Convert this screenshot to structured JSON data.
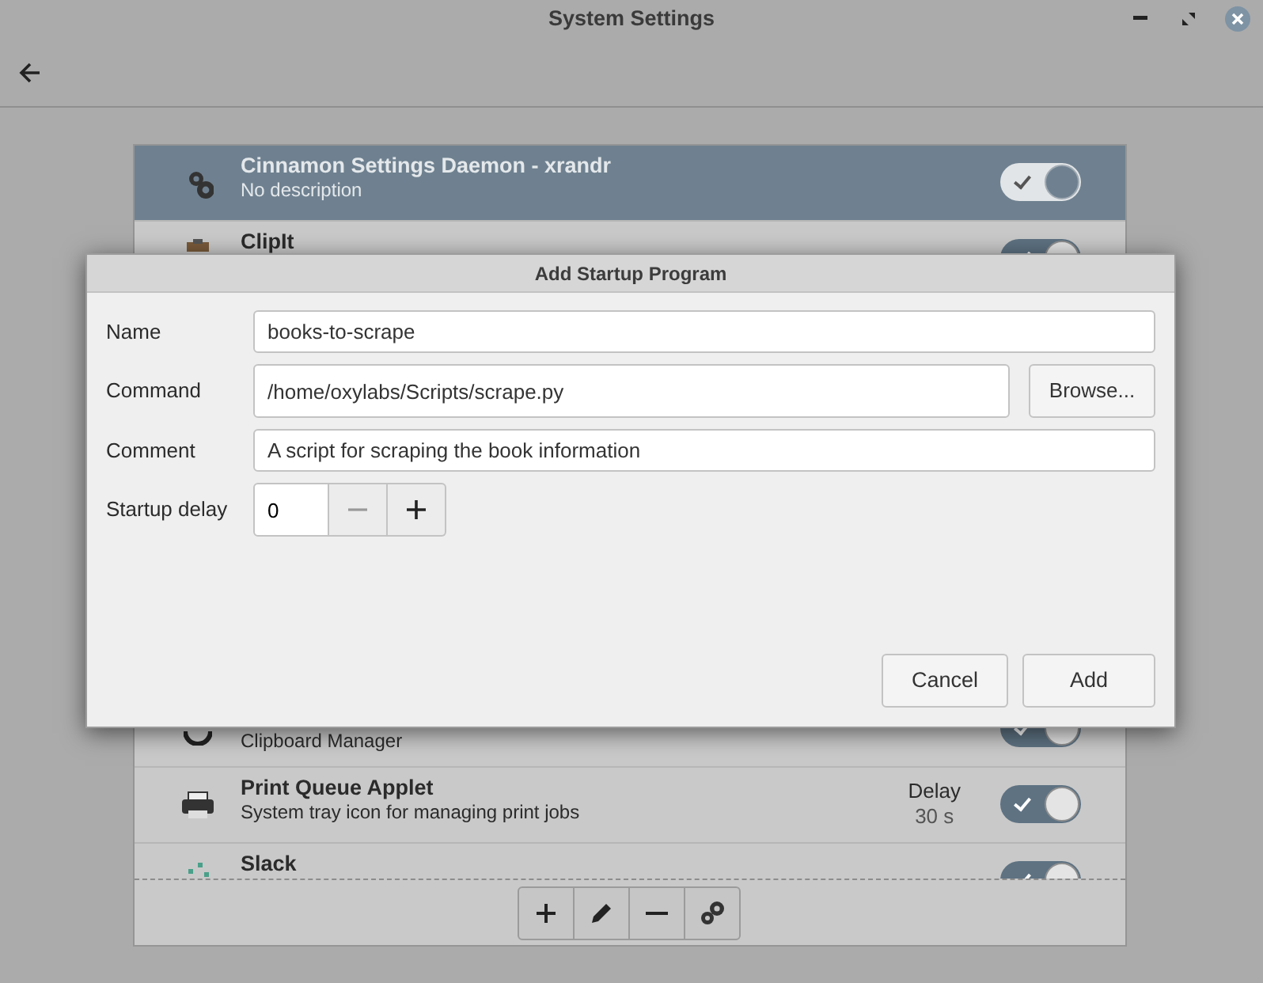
{
  "window": {
    "title": "System Settings"
  },
  "startup_programs": [
    {
      "name": "Cinnamon Settings Daemon - xrandr",
      "description": "No description",
      "selected": true,
      "enabled": true
    },
    {
      "name": "ClipIt",
      "selected": false,
      "enabled": true
    },
    {
      "description": "Clipboard Manager",
      "selected": false,
      "enabled": true
    },
    {
      "name": "Print Queue Applet",
      "description": "System tray icon for managing print jobs",
      "delay_label": "Delay",
      "delay": "30 s",
      "selected": false,
      "enabled": true
    },
    {
      "name": "Slack",
      "selected": false,
      "enabled": true
    }
  ],
  "dialog": {
    "title": "Add Startup Program",
    "fields": [
      {
        "label": "Name",
        "value": "books-to-scrape"
      },
      {
        "label": "Command",
        "value": "/home/oxylabs/Scripts/scrape.py",
        "button": "Browse..."
      },
      {
        "label": "Comment",
        "value": "A script for scraping the book information"
      }
    ],
    "startup_delay": {
      "label": "Startup delay",
      "value": "0"
    },
    "buttons": [
      "Cancel",
      "Add"
    ]
  }
}
